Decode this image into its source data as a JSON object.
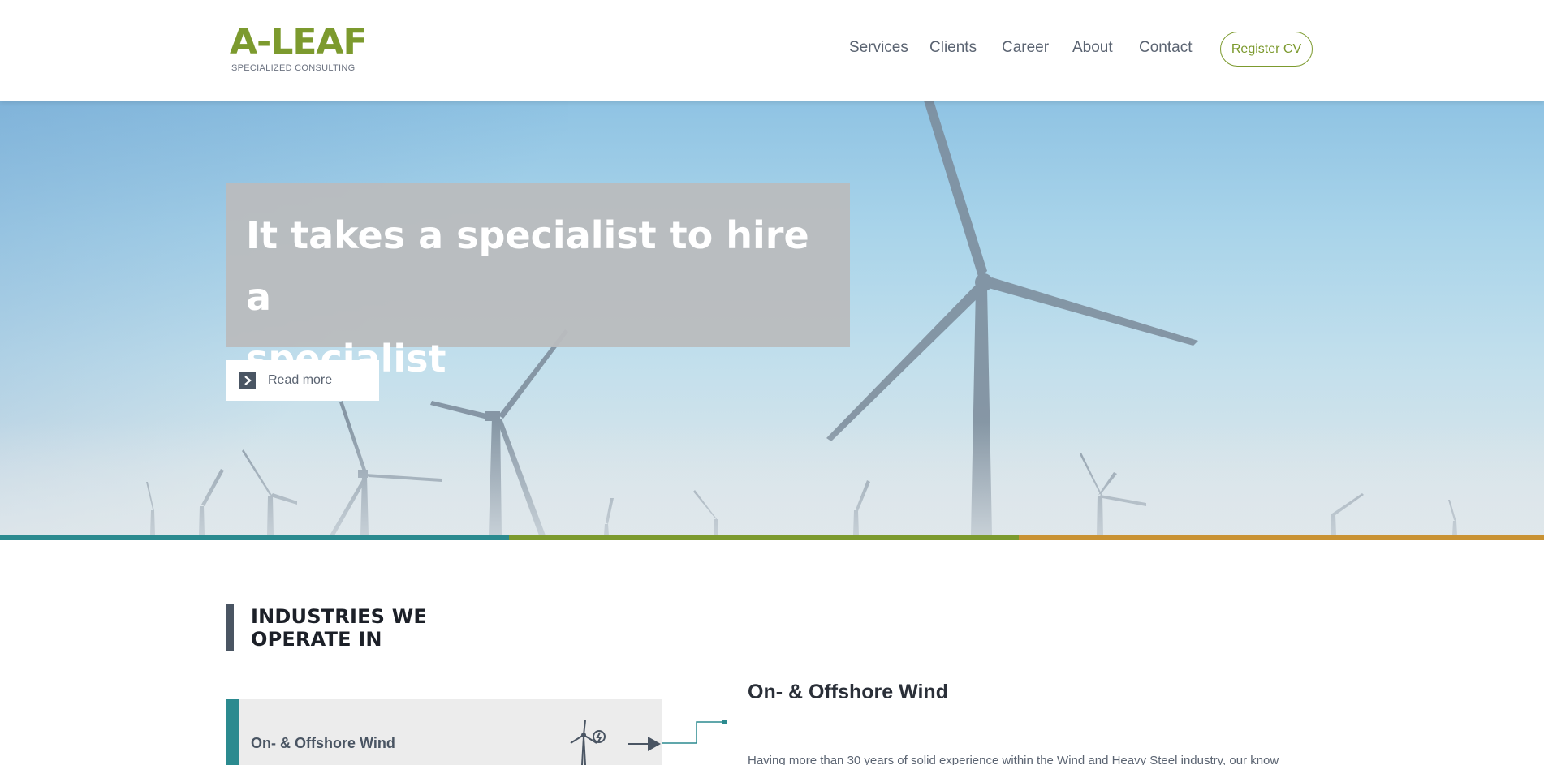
{
  "brand": {
    "name": "A-LEAF",
    "tagline": "SPECIALIZED CONSULTING",
    "accent": "#7c9a2e"
  },
  "nav": {
    "items": [
      "Services",
      "Clients",
      "Career",
      "About",
      "Contact"
    ],
    "register_label": "Register CV"
  },
  "hero": {
    "headline_line1": "It takes a specialist to hire a",
    "headline_line2": "specialist",
    "cta_label": "Read more",
    "cta_icon": "chevron-right-icon"
  },
  "stripe_colors": [
    "#2b8a8f",
    "#7c9a2e",
    "#c99233"
  ],
  "industries": {
    "title_line1": "INDUSTRIES WE",
    "title_line2": "OPERATE IN",
    "items": [
      {
        "label": "On- & Offshore Wind",
        "icon": "wind-turbine-icon",
        "color": "#2b8a8f"
      }
    ],
    "detail_title": "On- & Offshore Wind",
    "detail_text": "Having more than 30 years of solid experience within the Wind and Heavy Steel industry, our know"
  }
}
